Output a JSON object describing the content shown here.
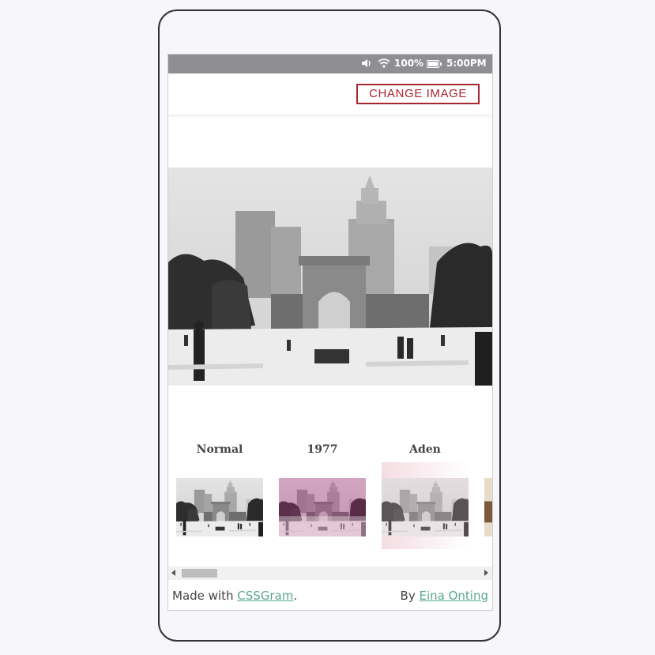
{
  "status_bar": {
    "volume_icon": "volume-icon",
    "wifi_icon": "wifi-icon",
    "battery_percent": "100%",
    "battery_icon": "battery-icon",
    "time": "5:00PM"
  },
  "app_bar": {
    "change_image_label": "CHANGE IMAGE",
    "accent_color": "#a8262e"
  },
  "filters": [
    {
      "label": "Normal"
    },
    {
      "label": "1977"
    },
    {
      "label": "Aden"
    }
  ],
  "footer": {
    "made_with_prefix": "Made with ",
    "made_with_link": "CSSGram",
    "made_with_suffix": ".",
    "by_prefix": "By ",
    "by_link": "Eina Onting",
    "link_color": "#5aa88a"
  }
}
